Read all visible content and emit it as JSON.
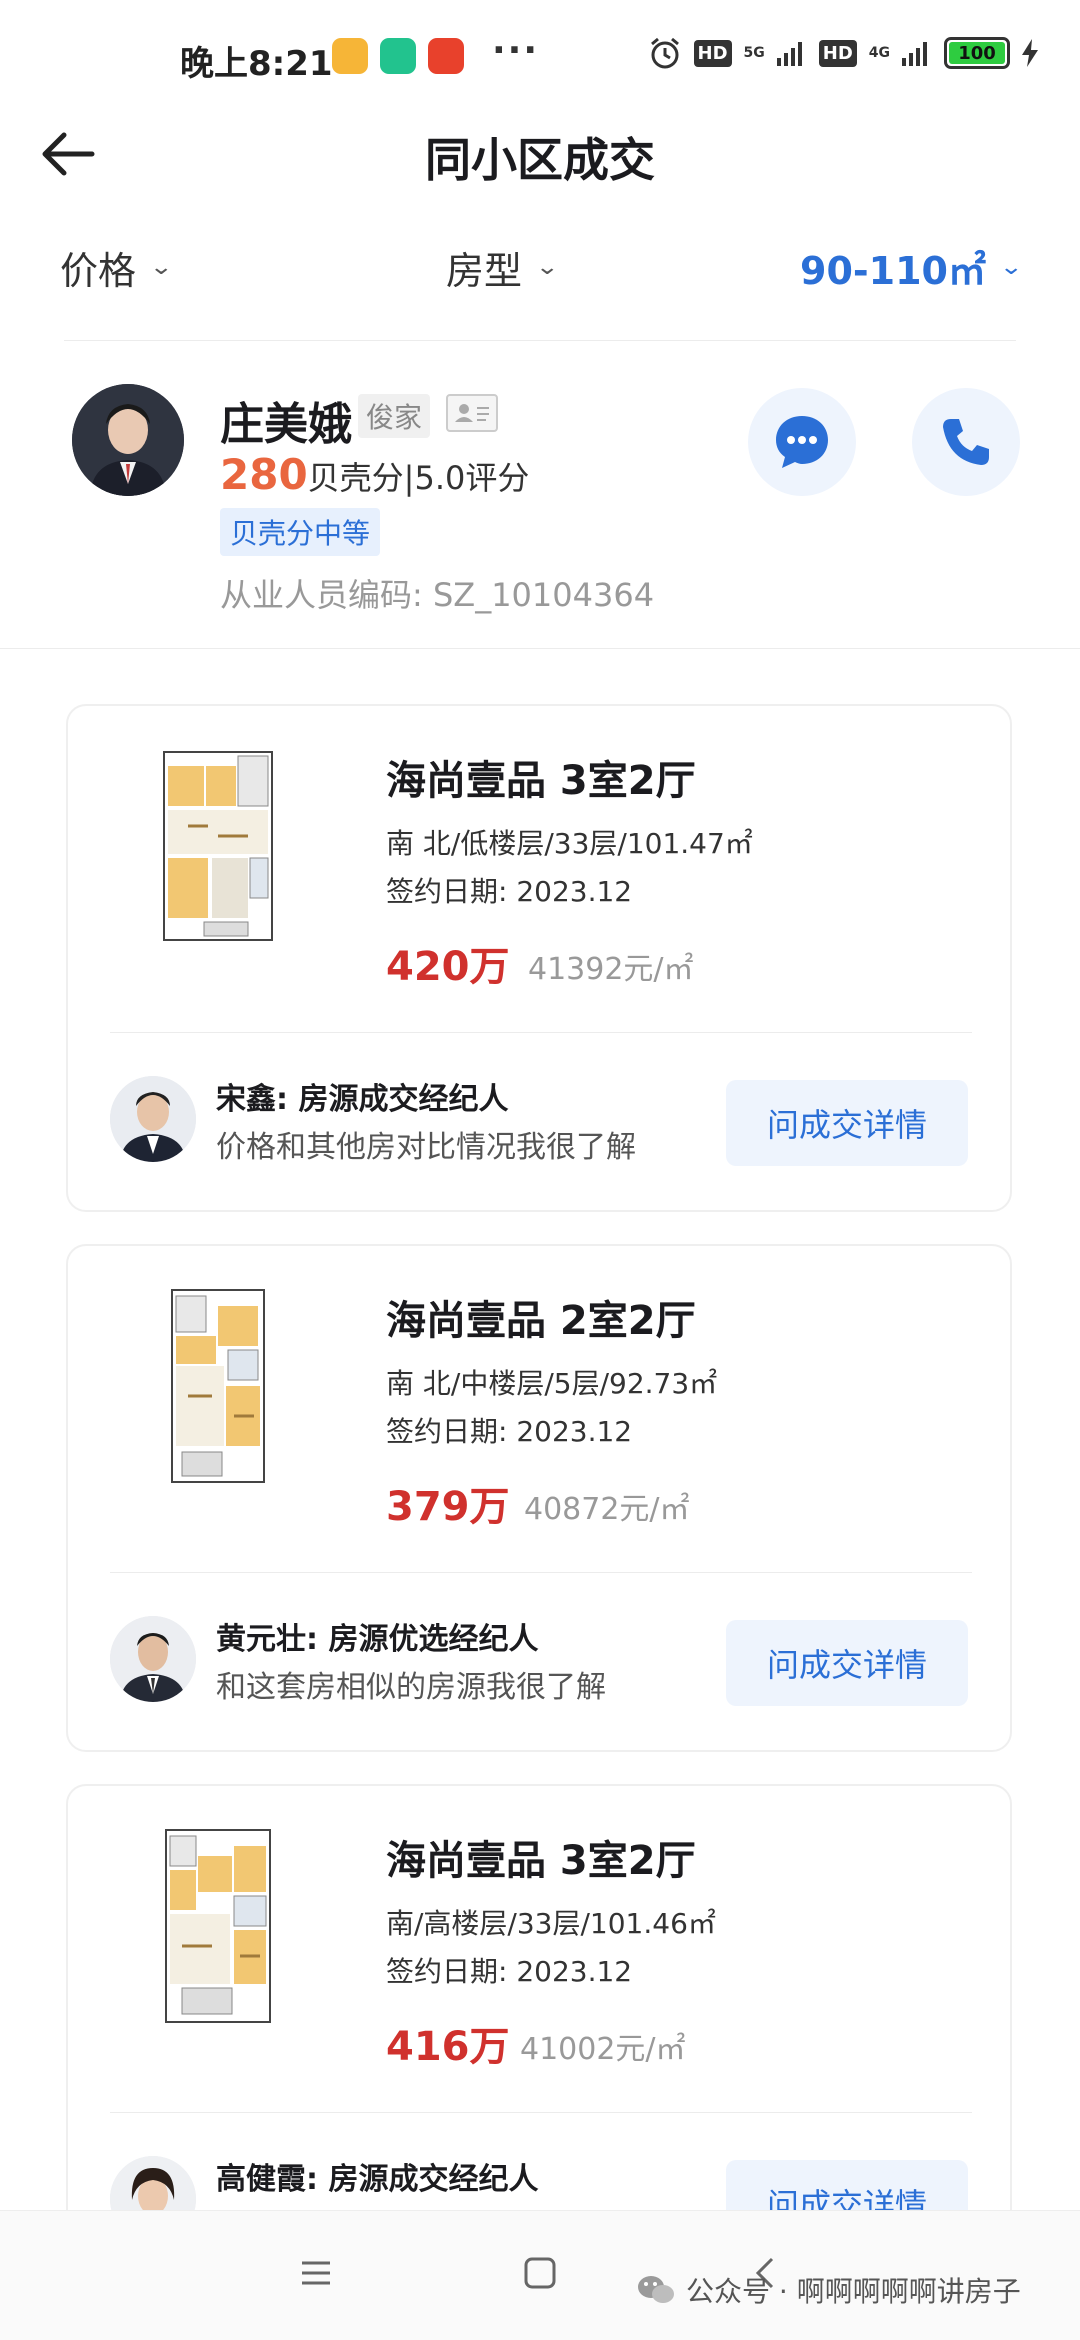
{
  "status_bar": {
    "time": "晚上8:21",
    "hd1": "HD",
    "net1": "5G",
    "hd2": "HD",
    "net2": "4G",
    "battery": "100"
  },
  "header": {
    "title": "同小区成交"
  },
  "filters": {
    "price": "价格",
    "layout": "房型",
    "area": "90-110㎡",
    "active_color": "#2b6fd6"
  },
  "agent": {
    "name": "庄美娥",
    "tag": "俊家",
    "score": "280",
    "score_suffix": "贝壳分|5.0评分",
    "level": "贝壳分中等",
    "code": "从业人员编码: SZ_10104364"
  },
  "listings": [
    {
      "title": "海尚壹品 3室2厅",
      "info": "南 北/低楼层/33层/101.47㎡",
      "date": "签约日期: 2023.12",
      "price": "420万",
      "unit_price": "41392元/㎡",
      "broker_name": "宋鑫: 房源成交经纪人",
      "broker_desc": "价格和其他房对比情况我很了解",
      "button": "问成交详情"
    },
    {
      "title": "海尚壹品 2室2厅",
      "info": "南 北/中楼层/5层/92.73㎡",
      "date": "签约日期: 2023.12",
      "price": "379万",
      "unit_price": "40872元/㎡",
      "broker_name": "黄元壮: 房源优选经纪人",
      "broker_desc": "和这套房相似的房源我很了解",
      "button": "问成交详情"
    },
    {
      "title": "海尚壹品 3室2厅",
      "info": "南/高楼层/33层/101.46㎡",
      "date": "签约日期: 2023.12",
      "price": "416万",
      "unit_price": "41002元/㎡",
      "broker_name": "高健霞: 房源成交经纪人",
      "broker_desc": "",
      "button": "问成交详情"
    }
  ],
  "watermark": "公众号 · 啊啊啊啊啊讲房子"
}
